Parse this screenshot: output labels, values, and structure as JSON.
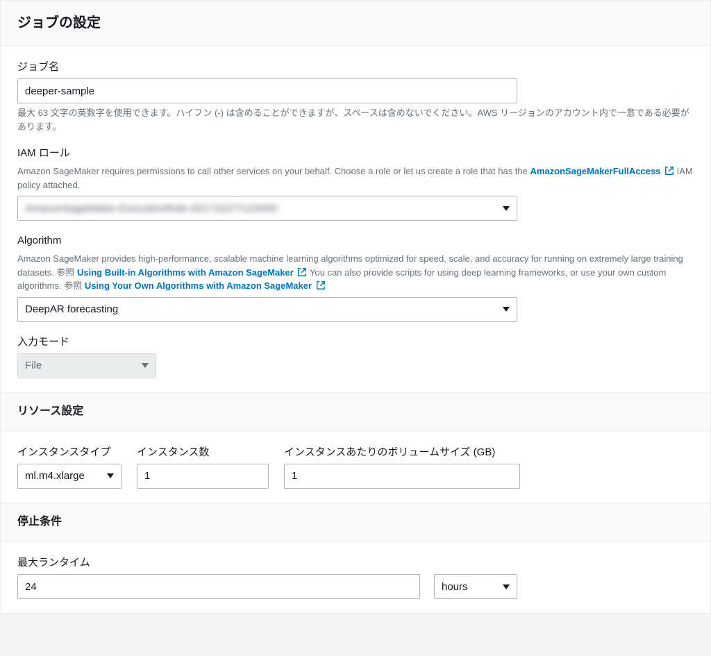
{
  "header": {
    "title": "ジョブの設定"
  },
  "jobName": {
    "label": "ジョブ名",
    "value": "deeper-sample",
    "hint": "最大 63 文字の英数字を使用できます。ハイフン (-) は含めることができますが、スペースは含めないでください。AWS リージョンのアカウント内で一意である必要があります。"
  },
  "iamRole": {
    "label": "IAM ロール",
    "hintPre1": "Amazon SageMaker requires permissions to call other services on your behalf. Choose a role or let us create a role that has the ",
    "link": "AmazonSageMakerFullAccess",
    "hintPre2": " IAM policy attached.",
    "value": "AmazonSageMaker-ExecutionRole-20171107T123456"
  },
  "algorithm": {
    "label": "Algorithm",
    "hint1": "Amazon SageMaker provides high-performance, scalable machine learning algorithms optimized for speed, scale, and accuracy for running on extremely large training datasets. 参照 ",
    "link1": "Using Built-in Algorithms with Amazon SageMaker",
    "hint2": " You can also provide scripts for using deep learning frameworks, or use your own custom algorithms.  参照 ",
    "link2": "Using Your Own Algorithms with Amazon SageMaker",
    "value": "DeepAR forecasting"
  },
  "inputMode": {
    "label": "入力モード",
    "value": "File"
  },
  "resource": {
    "title": "リソース設定",
    "instanceType": {
      "label": "インスタンスタイプ",
      "value": "ml.m4.xlarge"
    },
    "instanceCount": {
      "label": "インスタンス数",
      "value": "1"
    },
    "volumeSize": {
      "label": "インスタンスあたりのボリュームサイズ (GB)",
      "value": "1"
    }
  },
  "stop": {
    "title": "停止条件",
    "maxRuntime": {
      "label": "最大ランタイム",
      "value": "24",
      "unit": "hours"
    }
  }
}
